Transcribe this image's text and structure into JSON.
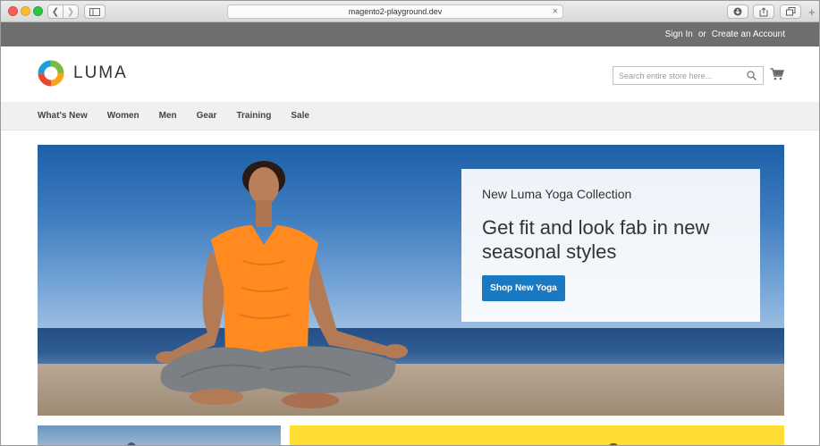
{
  "browser": {
    "url": "magento2-playground.dev"
  },
  "panel": {
    "sign_in": "Sign In",
    "or": "or",
    "create_account": "Create an Account"
  },
  "header": {
    "logo_text": "LUMA",
    "search_placeholder": "Search entire store here..."
  },
  "nav": {
    "items": [
      "What's New",
      "Women",
      "Men",
      "Gear",
      "Training",
      "Sale"
    ]
  },
  "hero": {
    "subtitle": "New Luma Yoga Collection",
    "title": "Get fit and look fab in new seasonal styles",
    "button": "Shop New Yoga"
  },
  "colors": {
    "panel_bg": "#6e6e6e",
    "nav_bg": "#f0f0f0",
    "button_blue": "#1979c3",
    "teaser_yellow": "#ffdd33"
  }
}
